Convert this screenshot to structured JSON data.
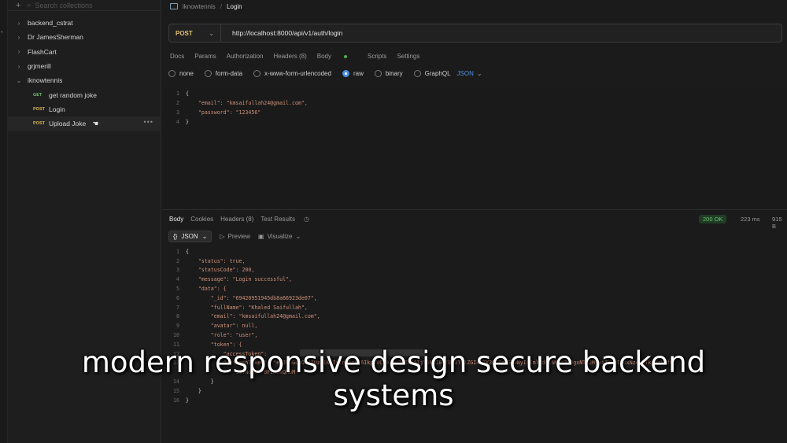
{
  "sidebar": {
    "search_placeholder": "Search collections",
    "collections": [
      {
        "name": "backend_cstrat",
        "expanded": false
      },
      {
        "name": "Dr JamesSherman",
        "expanded": false
      },
      {
        "name": "FlashCart",
        "expanded": false
      },
      {
        "name": "grjmerill",
        "expanded": false
      },
      {
        "name": "iknowtennis",
        "expanded": true
      }
    ],
    "requests": [
      {
        "method": "GET",
        "name": "get random joke"
      },
      {
        "method": "POST",
        "name": "Login"
      },
      {
        "method": "POST",
        "name": "Upload Joke"
      }
    ]
  },
  "breadcrumb": {
    "collection": "iknowtennis",
    "request": "Login"
  },
  "request": {
    "method": "POST",
    "url": "http://localhost:8000/api/v1/auth/login",
    "tabs": [
      "Docs",
      "Params",
      "Authorization",
      "Headers (8)",
      "Body",
      "Scripts",
      "Settings"
    ],
    "active_tab": "Body",
    "body_types": [
      "none",
      "form-data",
      "x-www-form-urlencoded",
      "raw",
      "binary",
      "GraphQL"
    ],
    "selected_body_type": "raw",
    "format": "JSON",
    "body_lines": [
      {
        "n": "1",
        "text": "{"
      },
      {
        "n": "2",
        "text": "    \"email\": \"kmsaifullah24@gmail.com\","
      },
      {
        "n": "3",
        "text": "    \"password\": \"123456\""
      },
      {
        "n": "4",
        "text": "}"
      }
    ]
  },
  "response": {
    "tabs": [
      "Body",
      "Cookies",
      "Headers (8)",
      "Test Results"
    ],
    "active_tab": "Body",
    "status": "200 OK",
    "time": "223 ms",
    "size": "915 B",
    "view_format": "JSON",
    "preview_label": "Preview",
    "visualize_label": "Visualize",
    "lines": [
      {
        "n": "1",
        "text": "{"
      },
      {
        "n": "2",
        "text": "    \"status\": true,"
      },
      {
        "n": "3",
        "text": "    \"statusCode\": 200,"
      },
      {
        "n": "4",
        "text": "    \"message\": \"Login successful\","
      },
      {
        "n": "5",
        "text": "    \"data\": {"
      },
      {
        "n": "6",
        "text": "        \"_id\": \"69420951945db8a66923de07\","
      },
      {
        "n": "7",
        "text": "        \"fullName\": \"Khaled Saifullah\","
      },
      {
        "n": "8",
        "text": "        \"email\": \"kmsaifullah24@gmail.com\","
      },
      {
        "n": "9",
        "text": "        \"avatar\": null,"
      },
      {
        "n": "10",
        "text": "        \"role\": \"user\","
      },
      {
        "n": "11",
        "text": "        \"token\": {"
      },
      {
        "n": "12",
        "text": "            \"accessToken\": "
      },
      {
        "n": "13",
        "text": "            \"refreshToken\": \"eyJhbGciOiJIUzI1NiIsInR5cCI6IkpXVCJ9.eyJpZCI6IjY5NDI0OTUxOTQ1ZGI4YTY2OTIzZGUwNyIsImlhdCI6MTc2ODgxNTM2MywiZXhwIjoxNzc2NTkxMzYzfQ."
      },
      {
        "n": "",
        "text": "                1IVNqpcY-8FIA5WQMuM"
      },
      {
        "n": "14",
        "text": "        }"
      },
      {
        "n": "15",
        "text": "    }"
      },
      {
        "n": "16",
        "text": "}"
      }
    ]
  },
  "caption": {
    "line1": "modern responsive design secure backend",
    "line2": "systems"
  }
}
